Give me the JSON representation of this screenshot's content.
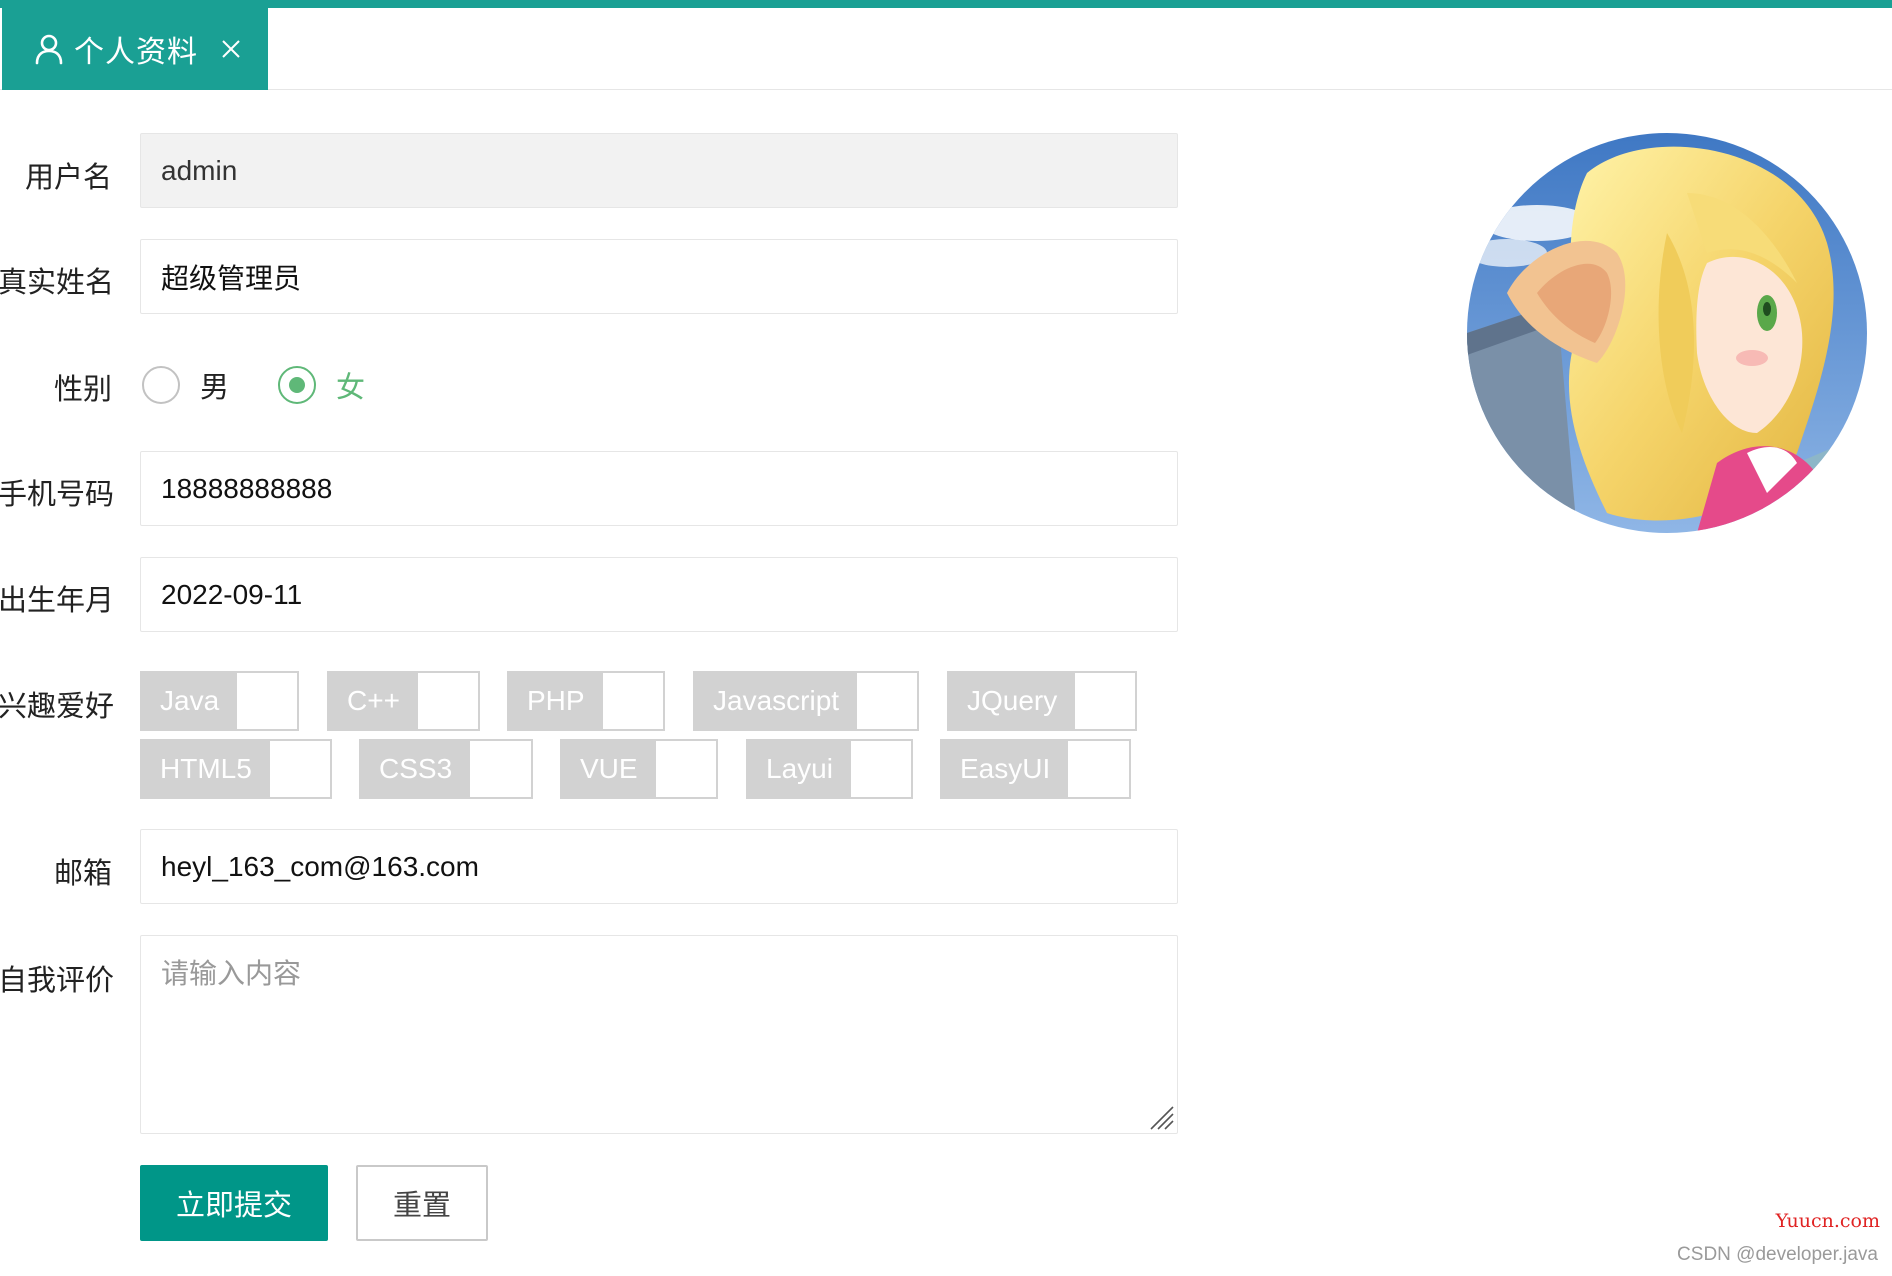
{
  "colors": {
    "accent": "#1aa094",
    "primary_button": "#009688",
    "radio_checked": "#5fb878",
    "checkbox_disabled": "#d2d2d2"
  },
  "tab": {
    "icon": "user-icon",
    "label": "个人资料",
    "close_icon": "close-icon"
  },
  "form": {
    "username": {
      "label": "用户名",
      "value": "admin"
    },
    "realname": {
      "label": "真实姓名",
      "value": "超级管理员"
    },
    "gender": {
      "label": "性别",
      "options": [
        {
          "label": "男",
          "checked": false
        },
        {
          "label": "女",
          "checked": true
        }
      ]
    },
    "phone": {
      "label": "手机号码",
      "value": "18888888888"
    },
    "birth": {
      "label": "出生年月",
      "value": "2022-09-11"
    },
    "hobbies": {
      "label": "兴趣爱好",
      "options": [
        "Java",
        "C++",
        "PHP",
        "Javascript",
        "JQuery",
        "HTML5",
        "CSS3",
        "VUE",
        "Layui",
        "EasyUI"
      ]
    },
    "email": {
      "label": "邮箱",
      "value": "heyl_163_com@163.com"
    },
    "self_eval": {
      "label": "自我评价",
      "placeholder": "请输入内容",
      "value": ""
    }
  },
  "buttons": {
    "submit": "立即提交",
    "reset": "重置"
  },
  "avatar": {
    "icon": "anime-avatar-image"
  },
  "watermarks": {
    "site": "Yuucn.com",
    "author": "CSDN @developer.java"
  }
}
